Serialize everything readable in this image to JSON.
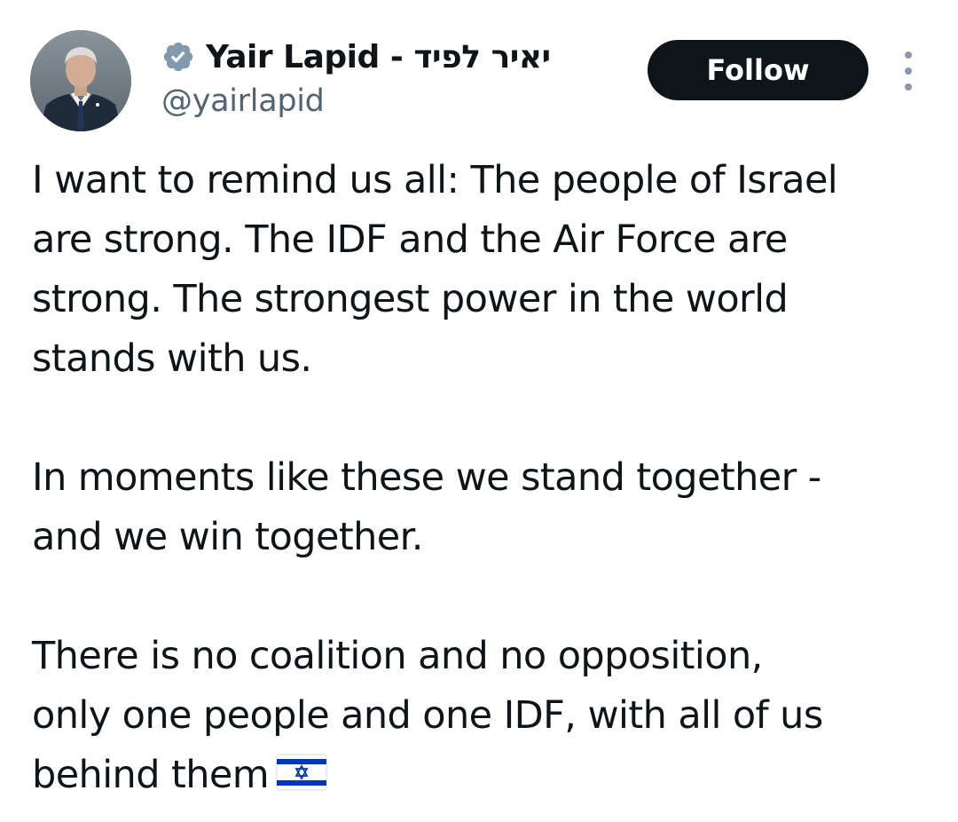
{
  "author": {
    "display_name": "Yair Lapid - יאיר לפיד",
    "handle": "@yairlapid",
    "verified": true,
    "avatar_icon": "profile-photo"
  },
  "actions": {
    "follow_label": "Follow",
    "more_icon": "vertical-ellipsis-icon"
  },
  "tweet": {
    "paragraphs": [
      "I want to remind us all: The people of Israel\nare strong. The IDF and the Air Force are\nstrong. The strongest power in the world\nstands with us.",
      "In moments like these we stand together -\nand we win together.",
      "There is no coalition and no opposition,\nonly one people and one IDF, with all of us\nbehind them"
    ],
    "trailing_emoji": "israel-flag-emoji"
  },
  "colors": {
    "text": "#0f1419",
    "secondary_text": "#536471",
    "follow_bg": "#0f1419",
    "verified_badge": "#829aab",
    "flag_blue": "#0038b8"
  }
}
